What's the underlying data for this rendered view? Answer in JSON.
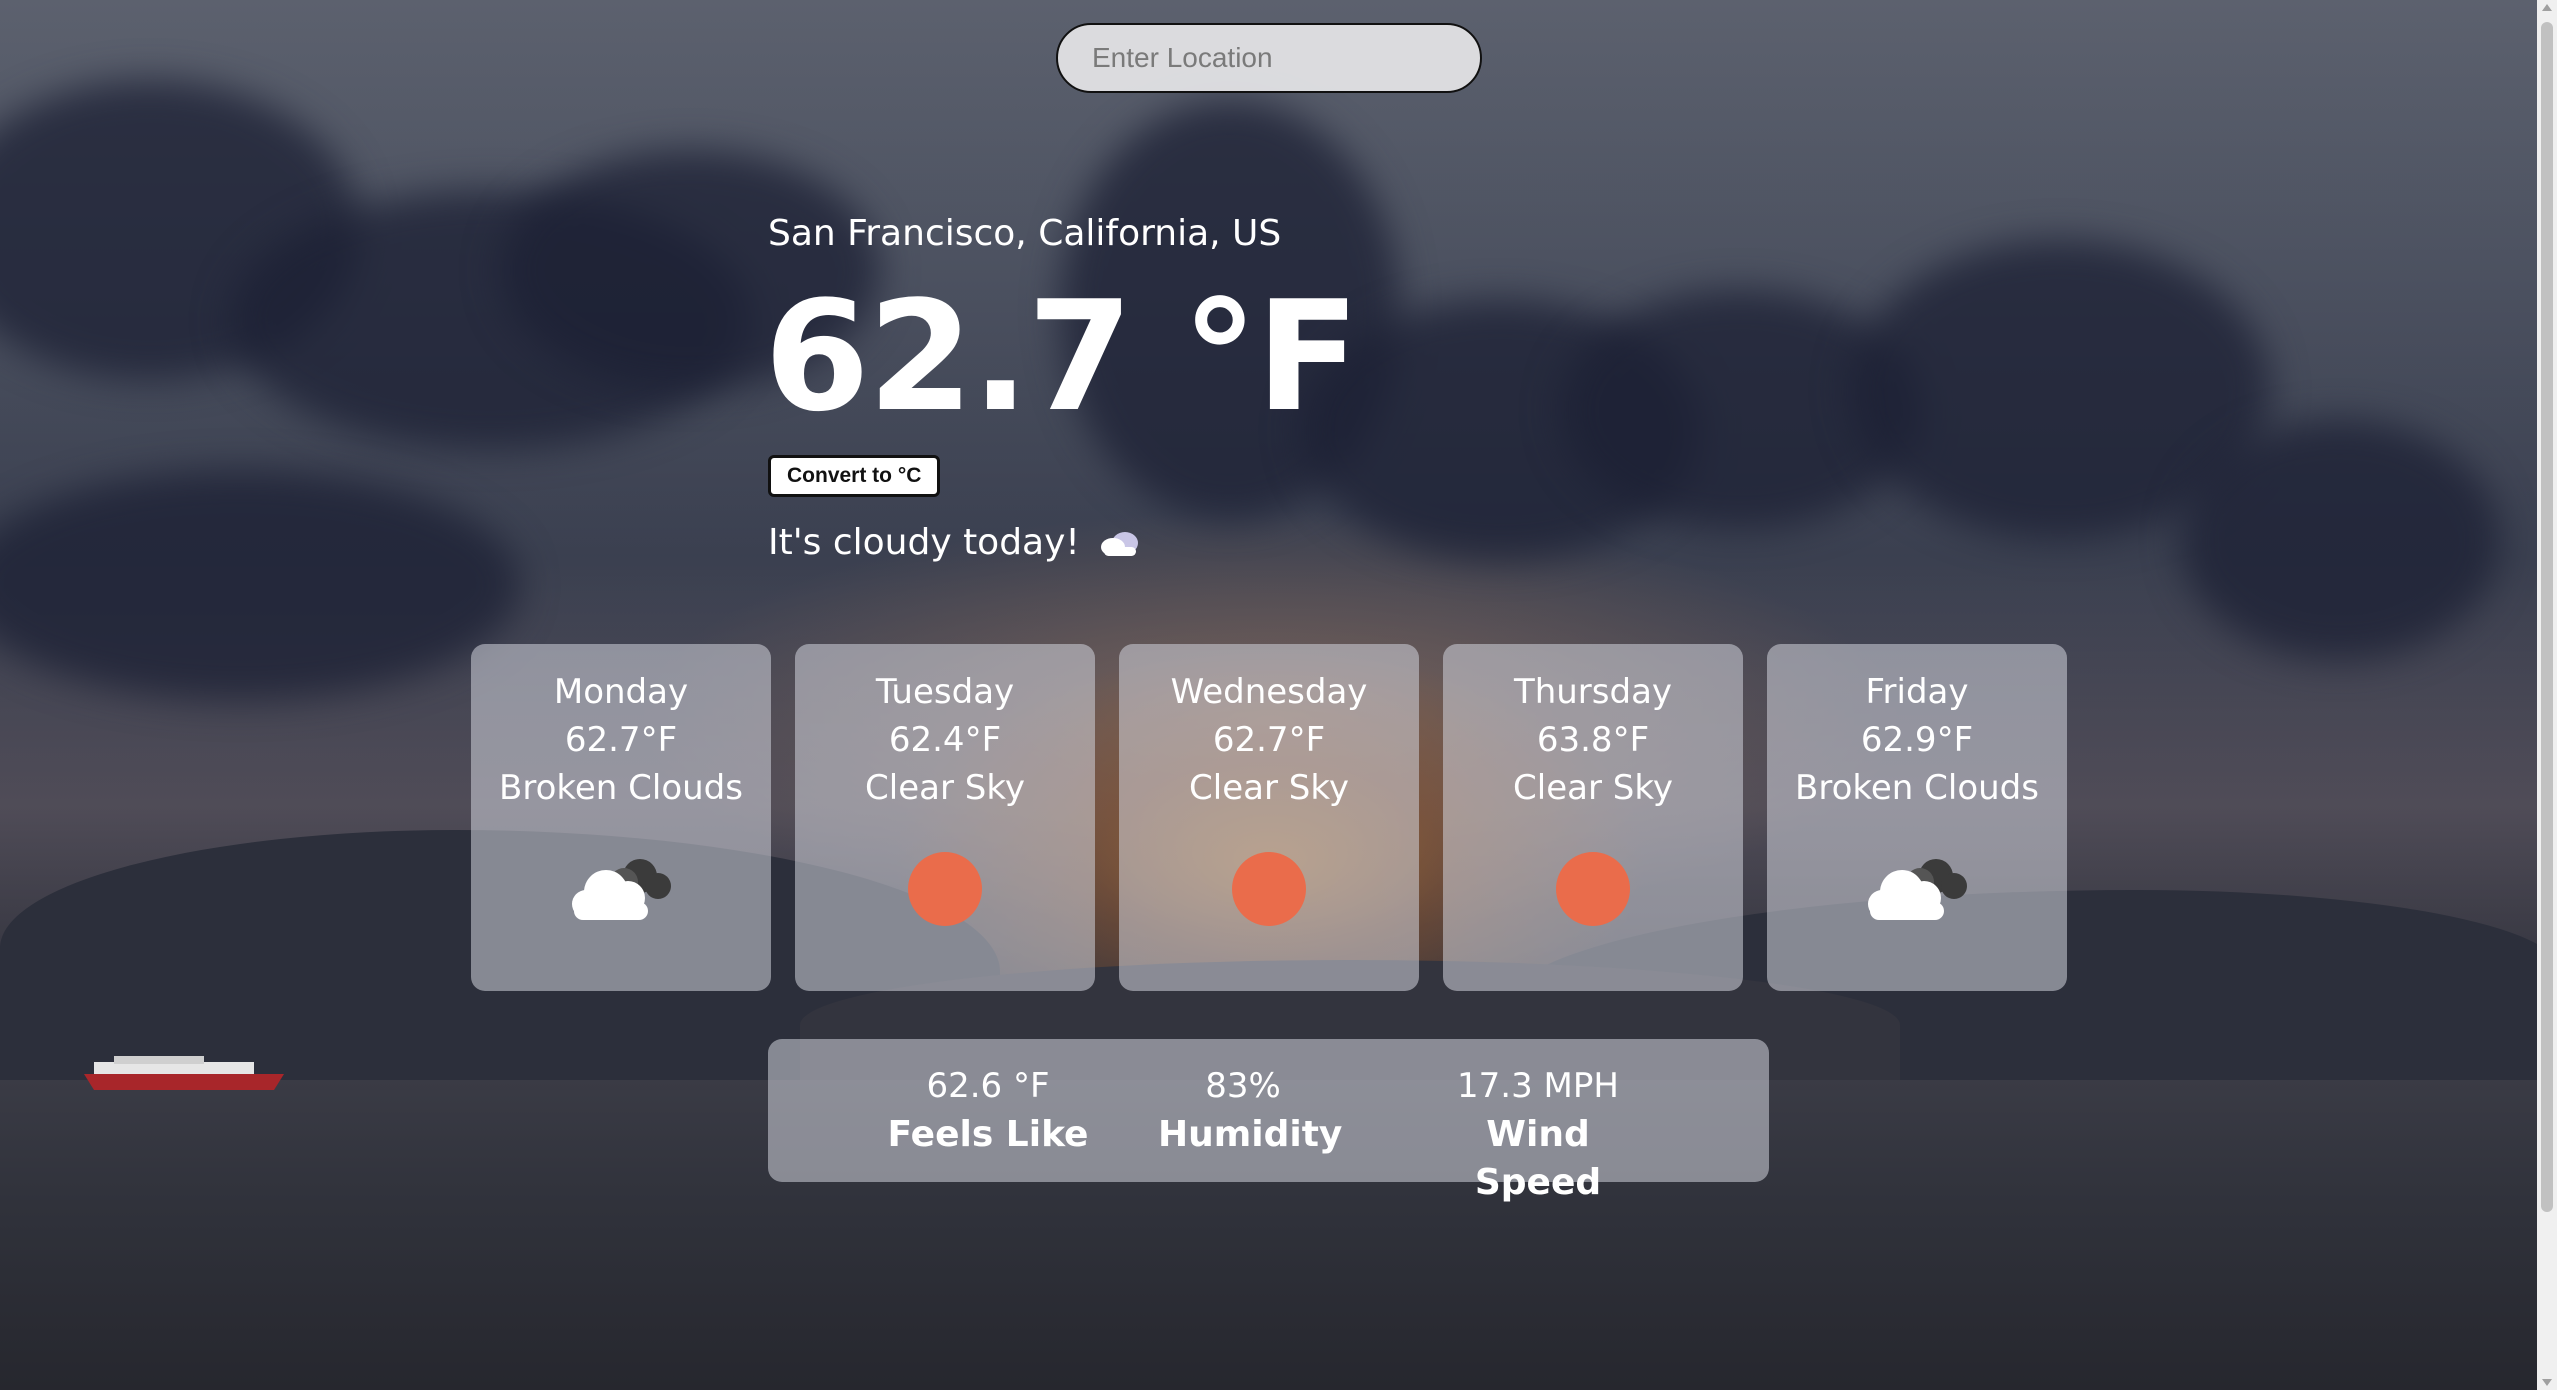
{
  "search": {
    "placeholder": "Enter Location"
  },
  "current": {
    "location": "San Francisco, California, US",
    "temperature": "62.7 °F",
    "convert_label": "Convert to °C",
    "summary": "It's cloudy today!"
  },
  "forecast": [
    {
      "day": "Monday",
      "temp": "62.7°F",
      "condition": "Broken Clouds",
      "icon": "cloud-icon"
    },
    {
      "day": "Tuesday",
      "temp": "62.4°F",
      "condition": "Clear Sky",
      "icon": "sun-icon"
    },
    {
      "day": "Wednesday",
      "temp": "62.7°F",
      "condition": "Clear Sky",
      "icon": "sun-icon"
    },
    {
      "day": "Thursday",
      "temp": "63.8°F",
      "condition": "Clear Sky",
      "icon": "sun-icon"
    },
    {
      "day": "Friday",
      "temp": "62.9°F",
      "condition": "Broken Clouds",
      "icon": "cloud-icon"
    }
  ],
  "details": {
    "feels_like": {
      "value": "62.6 °F",
      "label": "Feels Like"
    },
    "humidity": {
      "value": "83%",
      "label": "Humidity"
    },
    "wind": {
      "value": "17.3 MPH",
      "label": "Wind Speed"
    }
  },
  "colors": {
    "sun": "#ea6c4b",
    "card": "#d2d4dc"
  }
}
